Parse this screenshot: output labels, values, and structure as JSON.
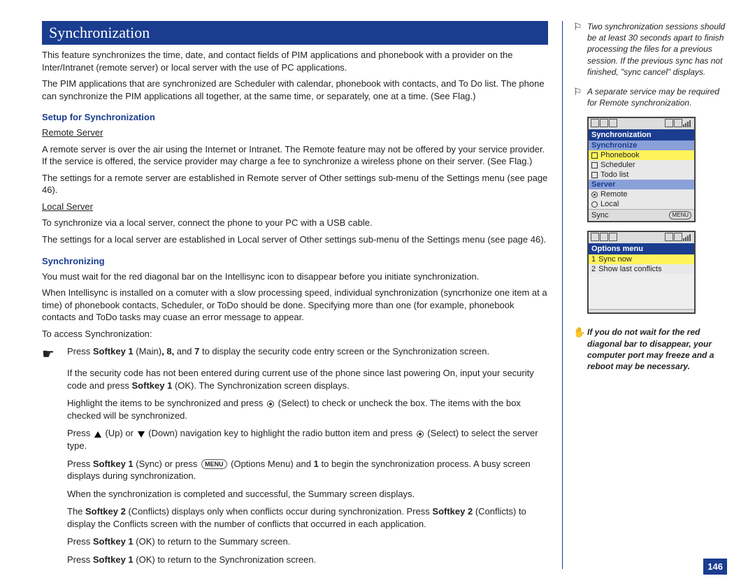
{
  "page_number": "146",
  "title": "Synchronization",
  "intro1": "This feature synchronizes the time, date, and contact fields of PIM applications and phonebook with a provider on the Inter/Intranet (remote server) or local server with the use of PC applications.",
  "intro2": "The PIM applications that are synchronized are Scheduler with calendar, phonebook with contacts, and To Do list. The phone can synchronize the PIM applications all together, at the same time, or separately, one at a time. (See Flag.)",
  "setup_heading": "Setup for Synchronization",
  "remote_server_label": "Remote Server",
  "remote_p1": "A remote server is over the air using the Internet or Intranet. The Remote feature may not be offered by your service provider. If the service is offered, the service provider may charge a fee to synchronize a wireless phone on their server. (See Flag.)",
  "remote_p2": "The settings for a remote server are established in Remote server of Other settings sub-menu of the Settings menu (see page 46).",
  "local_server_label": "Local Server",
  "local_p1": "To synchronize via a local server, connect the phone to your PC with a USB cable.",
  "local_p2": "The settings for a local server are established in Local server of Other settings sub-menu of the Settings menu (see page 46).",
  "sync_heading": "Synchronizing",
  "sync_p1": "You must wait for the red diagonal bar on the Intellisync icon to disappear before you initiate synchronization.",
  "sync_p2": "When Intellisync is installed on a comuter with a slow processing speed, individual synchronization (syncrhonize one item at a time) of phonebook contacts, Scheduler, or ToDo should be done. Specifying more than one (for example, phonebook contacts and ToDo tasks may cuase an error message to appear.",
  "sync_access": "To access Synchronization:",
  "step1_a": "Press ",
  "step1_b": "Softkey 1",
  "step1_c": " (Main)",
  "step1_d": ", 8,",
  "step1_e": " and ",
  "step1_f": "7",
  "step1_g": " to display the security code entry screen or the Synchronization screen.",
  "step2_a": "If the security code has not been entered during current use of the phone since last powering On, input your security code and press ",
  "step2_b": "Softkey 1",
  "step2_c": " (OK). The Synchronization screen displays.",
  "step3_a": "Highlight the items to be synchronized and press ",
  "step3_b": " (Select) to check or uncheck the box. The items with the box checked will be synchronized.",
  "step4_a": "Press ",
  "step4_b": " (Up) or ",
  "step4_c": " (Down) navigation key to highlight the radio button item and press ",
  "step4_d": " (Select) to select the server type.",
  "step5_a": "Press ",
  "step5_b": "Softkey 1",
  "step5_c": " (Sync) or press ",
  "step5_menu": "MENU",
  "step5_d": " (Options Menu) and ",
  "step5_e": "1",
  "step5_f": " to begin the synchronization process. A busy screen displays during synchronization.",
  "step6": "When the synchronization is completed and successful, the Summary screen displays.",
  "step7_a": "The ",
  "step7_b": "Softkey 2",
  "step7_c": " (Conflicts) displays only when conflicts occur during synchronization. Press ",
  "step7_d": "Softkey 2",
  "step7_e": " (Conflicts) to display the Conflicts screen with the number of conflicts that occurred in each application.",
  "step8_a": "Press ",
  "step8_b": "Softkey 1",
  "step8_c": " (OK) to return to the Summary screen.",
  "step9_a": "Press ",
  "step9_b": "Softkey 1",
  "step9_c": " (OK) to return to the Synchronization screen.",
  "flag1": "Two synchronization sessions should be at least 30 seconds apart to finish processing the files for a previous session. If the previous sync has not finished, \"sync cancel\" displays.",
  "flag2": "A separate service may be required for Remote synchronization.",
  "warn": "If you do not wait for the red diagonal bar to disappear, your computer port may freeze and a reboot may be necessary.",
  "screen1": {
    "title": "Synchronization",
    "sect1": "Synchronize",
    "i1": "Phonebook",
    "i2": "Scheduler",
    "i3": "Todo list",
    "sect2": "Server",
    "r1": "Remote",
    "r2": "Local",
    "foot1": "Sync",
    "foot2": "MENU"
  },
  "screen2": {
    "title": "Options menu",
    "o1": "Sync now",
    "o2": "Show last conflicts",
    "n1": "1",
    "n2": "2"
  }
}
